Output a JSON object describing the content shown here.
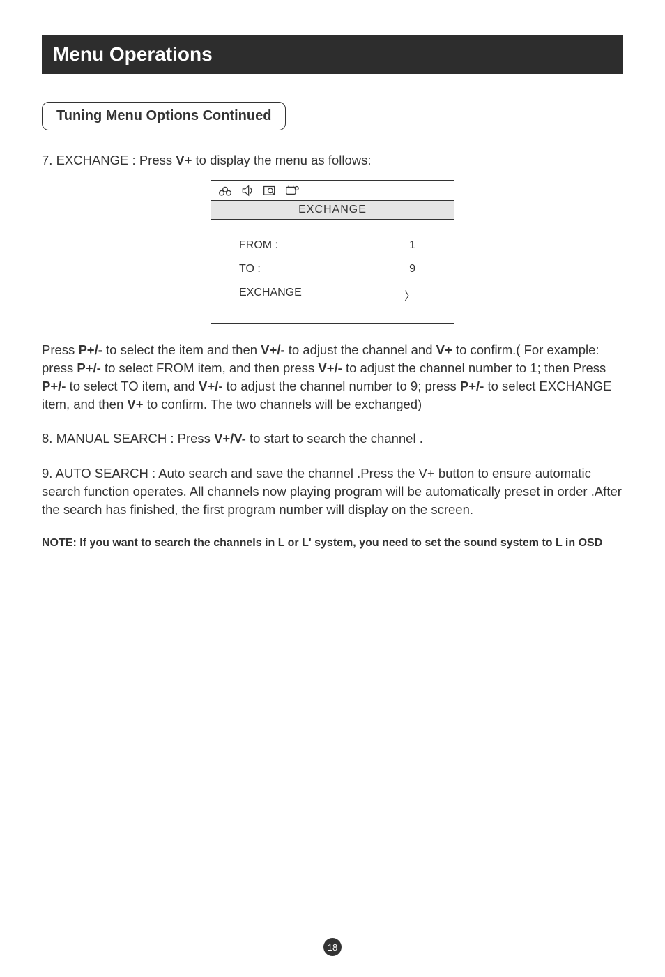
{
  "header": "Menu Operations",
  "subheader": "Tuning Menu Options Continued",
  "para7_a": "7. EXCHANGE : Press ",
  "para7_b": "V+",
  "para7_c": " to display the menu as follows:",
  "osd": {
    "title": "EXCHANGE",
    "rows": [
      {
        "label": "FROM :",
        "value": "1"
      },
      {
        "label": "TO :",
        "value": "9"
      },
      {
        "label": "EXCHANGE",
        "value": "〉"
      }
    ]
  },
  "explain": {
    "t1": "Press ",
    "b1": "P+/-",
    "t2": " to select the item and then ",
    "b2": "V+/-",
    "t3": " to adjust the channel and ",
    "b3": "V+",
    "t4": " to confirm.( For example: press ",
    "b4": "P+/-",
    "t5": " to select FROM item, and then press ",
    "b5": "V+/-",
    "t6": " to adjust the channel number to 1; then Press ",
    "b6": "P+/-",
    "t7": " to select TO item, and ",
    "b7": "V+/-",
    "t8": " to adjust the channel number to 9; press ",
    "b8": "P+/-",
    "t9": " to select EXCHANGE item, and then ",
    "b9": "V+",
    "t10": " to confirm. The two channels will be exchanged)"
  },
  "para8": {
    "t1": "8. MANUAL SEARCH : Press ",
    "b1": "V+/V-",
    "t2": " to start to search the channel ."
  },
  "para9": "9. AUTO SEARCH : Auto search and save the channel .Press the V+ button to ensure automatic search function operates. All channels now playing program will be automatically preset in order .After the search has finished, the first program number will display on the screen.",
  "note_a": "NOTE: If you want to search the channels in L or L",
  "note_ap": "'",
  "note_b": " system, you need to set the sound system to L in OSD",
  "page_num": "18"
}
